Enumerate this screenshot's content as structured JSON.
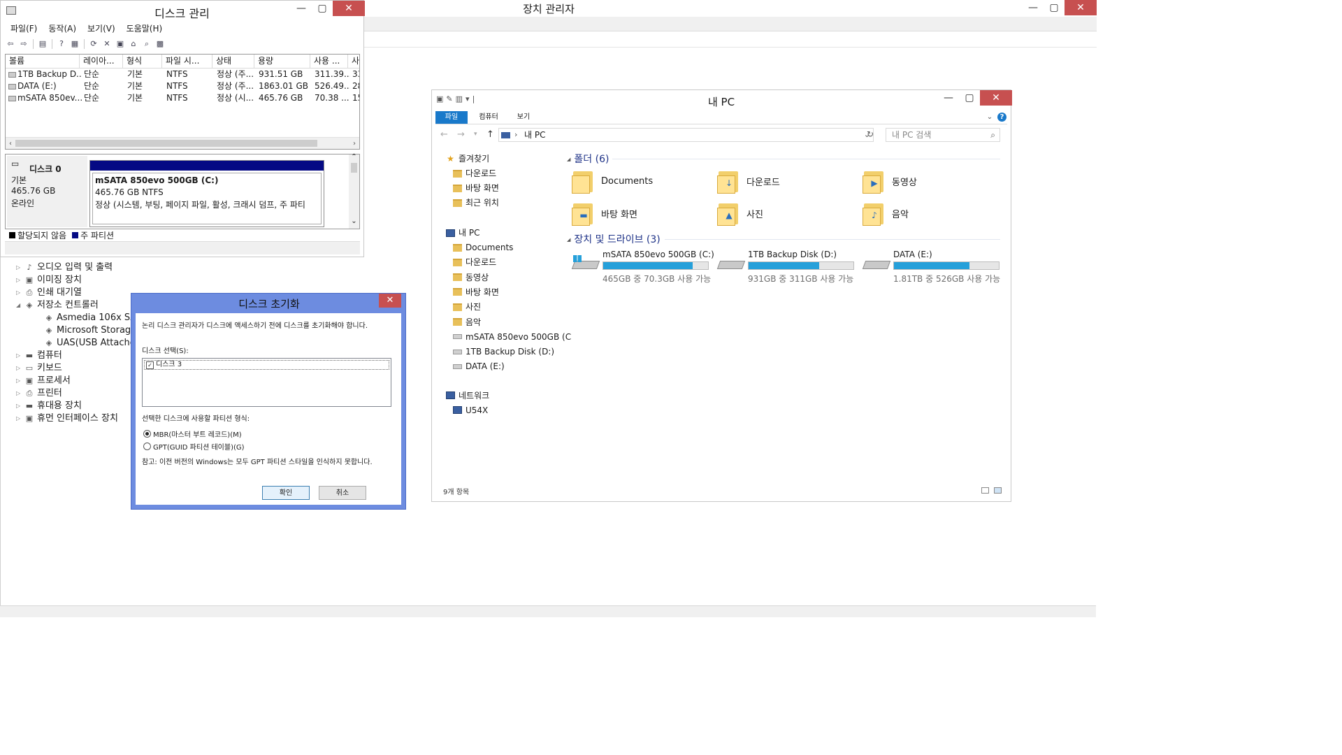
{
  "device_manager": {
    "title": "장치 관리자",
    "window_buttons": {
      "minimize": "—",
      "maximize": "▢",
      "close": "✕"
    },
    "tree": [
      {
        "label": "오디오 입력 및 출력",
        "arrow": "▷",
        "icon": "audio-icon",
        "glyph": "♪",
        "indent": 0
      },
      {
        "label": "이미징 장치",
        "arrow": "▷",
        "icon": "camera-icon",
        "glyph": "▣",
        "indent": 0
      },
      {
        "label": "인쇄 대기열",
        "arrow": "▷",
        "icon": "printer-icon",
        "glyph": "⎙",
        "indent": 0
      },
      {
        "label": "저장소 컨트롤러",
        "arrow": "◢",
        "icon": "storage-controller-icon",
        "glyph": "◈",
        "indent": 0
      },
      {
        "label": "Asmedia 106x SATA C",
        "arrow": "",
        "icon": "storage-controller-icon",
        "glyph": "◈",
        "indent": 1
      },
      {
        "label": "Microsoft Storage Spa",
        "arrow": "",
        "icon": "storage-controller-icon",
        "glyph": "◈",
        "indent": 1
      },
      {
        "label": "UAS(USB Attached SC",
        "arrow": "",
        "icon": "storage-controller-icon",
        "glyph": "◈",
        "indent": 1
      },
      {
        "label": "컴퓨터",
        "arrow": "▷",
        "icon": "computer-icon",
        "glyph": "▬",
        "indent": 0
      },
      {
        "label": "키보드",
        "arrow": "▷",
        "icon": "keyboard-icon",
        "glyph": "▭",
        "indent": 0
      },
      {
        "label": "프로세서",
        "arrow": "▷",
        "icon": "processor-icon",
        "glyph": "▣",
        "indent": 0
      },
      {
        "label": "프린터",
        "arrow": "▷",
        "icon": "printer-icon",
        "glyph": "⎙",
        "indent": 0
      },
      {
        "label": "휴대용 장치",
        "arrow": "▷",
        "icon": "portable-device-icon",
        "glyph": "▬",
        "indent": 0
      },
      {
        "label": "휴먼 인터페이스 장치",
        "arrow": "▷",
        "icon": "hid-icon",
        "glyph": "▣",
        "indent": 0
      }
    ]
  },
  "disk_management": {
    "title": "디스크 관리",
    "window_buttons": {
      "minimize": "—",
      "maximize": "▢",
      "close": "✕"
    },
    "menu": [
      "파일(F)",
      "동작(A)",
      "보기(V)",
      "도움말(H)"
    ],
    "toolbar_icons": [
      {
        "name": "back-icon",
        "glyph": "⇦"
      },
      {
        "name": "forward-icon",
        "glyph": "⇨"
      },
      {
        "name": "sep",
        "glyph": ""
      },
      {
        "name": "console-tree-icon",
        "glyph": "▤"
      },
      {
        "name": "sep",
        "glyph": ""
      },
      {
        "name": "help-icon",
        "glyph": "?"
      },
      {
        "name": "properties-list-icon",
        "glyph": "▦"
      },
      {
        "name": "sep",
        "glyph": ""
      },
      {
        "name": "refresh-icon",
        "glyph": "⟳"
      },
      {
        "name": "delete-icon",
        "glyph": "✕"
      },
      {
        "name": "properties-icon",
        "glyph": "▣"
      },
      {
        "name": "open-folder-icon",
        "glyph": "⌂"
      },
      {
        "name": "search-icon",
        "glyph": "⌕"
      },
      {
        "name": "settings-icon",
        "glyph": "▩"
      }
    ],
    "columns": [
      "볼륨",
      "레이아...",
      "형식",
      "파일 시...",
      "상태",
      "용량",
      "사용 ...",
      "사"
    ],
    "volumes": [
      [
        "1TB Backup D...",
        "단순",
        "기본",
        "NTFS",
        "정상 (주...",
        "931.51 GB",
        "311.39...",
        "33"
      ],
      [
        "DATA (E:)",
        "단순",
        "기본",
        "NTFS",
        "정상 (주...",
        "1863.01 GB",
        "526.49...",
        "28"
      ],
      [
        "mSATA 850ev...",
        "단순",
        "기본",
        "NTFS",
        "정상 (시...",
        "465.76 GB",
        "70.38 ...",
        "15"
      ]
    ],
    "scroll_left": "‹",
    "scroll_right": "›",
    "scroll_up": "⌃",
    "scroll_down": "⌄",
    "disk": {
      "name": "디스크 0",
      "type": "기본",
      "size": "465.76 GB",
      "status": "온라인",
      "partition_title": "mSATA 850evo 500GB  (C:)",
      "partition_size": "465.76 GB NTFS",
      "partition_status": "정상 (시스템, 부팅, 페이지 파일, 활성, 크래시 덤프, 주 파티"
    },
    "legend": [
      {
        "label": "할당되지 않음",
        "color": "#000000"
      },
      {
        "label": "주 파티션",
        "color": "#050a84"
      }
    ]
  },
  "init_dialog": {
    "title": "디스크 초기화",
    "close": "✕",
    "intro": "논리 디스크 관리자가 디스크에 액세스하기 전에 디스크를 초기화해야 합니다.",
    "select_label": "디스크 선택(S):",
    "disks": [
      {
        "label": "디스크 3",
        "checked": true
      }
    ],
    "check_mark": "✓",
    "partition_label": "선택한 디스크에 사용할 파티션 형식:",
    "options": [
      {
        "label": "MBR(마스터 부트 레코드)(M)",
        "selected": true
      },
      {
        "label": "GPT(GUID 파티션 테이블)(G)",
        "selected": false
      }
    ],
    "note": "참고: 이전 버전의 Windows는 모두 GPT 파티션 스타일을 인식하지 못합니다.",
    "ok": "확인",
    "cancel": "취소"
  },
  "explorer": {
    "title": "내 PC",
    "window_buttons": {
      "minimize": "—",
      "maximize": "▢",
      "close": "✕"
    },
    "qat_glyphs": [
      "▣",
      "✎",
      "▥",
      "▾",
      "|"
    ],
    "ribbon_tabs": [
      "파일",
      "컴퓨터",
      "보기"
    ],
    "ribbon_expand": "⌄",
    "help": "?",
    "nav_buttons": {
      "back": "←",
      "forward": "→",
      "recent": "▾",
      "up": "↑"
    },
    "address": "내 PC",
    "address_separator": "›",
    "address_dropdown": "⌄",
    "refresh": "↻",
    "search_placeholder": "내 PC 검색",
    "search_glyph": "⌕",
    "nav": {
      "favorites": "즐겨찾기",
      "favorites_items": [
        "다운로드",
        "바탕 화면",
        "최근 위치"
      ],
      "this_pc": "내 PC",
      "this_pc_items": [
        "Documents",
        "다운로드",
        "동영상",
        "바탕 화면",
        "사진",
        "음악"
      ],
      "drives": [
        "mSATA 850evo 500GB (C",
        "1TB Backup Disk (D:)",
        "DATA (E:)"
      ],
      "network": "네트워크",
      "network_items": [
        "U54X"
      ]
    },
    "folders_header": "폴더 (6)",
    "folders": [
      {
        "label": "Documents",
        "icon": "documents-folder-icon",
        "badge": ""
      },
      {
        "label": "다운로드",
        "icon": "downloads-folder-icon",
        "badge": "↓"
      },
      {
        "label": "동영상",
        "icon": "videos-folder-icon",
        "badge": "▶"
      },
      {
        "label": "바탕 화면",
        "icon": "desktop-folder-icon",
        "badge": "▬"
      },
      {
        "label": "사진",
        "icon": "pictures-folder-icon",
        "badge": "▲"
      },
      {
        "label": "음악",
        "icon": "music-folder-icon",
        "badge": "♪"
      }
    ],
    "drives_header": "장치 및 드라이브 (3)",
    "drives": [
      {
        "name": "mSATA 850evo 500GB (C:)",
        "free": "465GB 중 70.3GB 사용 가능",
        "used_fraction": 0.85,
        "icon": "system-drive-icon"
      },
      {
        "name": "1TB Backup Disk (D:)",
        "free": "931GB 중 311GB 사용 가능",
        "used_fraction": 0.67,
        "icon": "drive-icon"
      },
      {
        "name": "DATA (E:)",
        "free": "1.81TB 중 526GB 사용 가능",
        "used_fraction": 0.72,
        "icon": "drive-icon"
      }
    ],
    "status": "9개 항목"
  }
}
